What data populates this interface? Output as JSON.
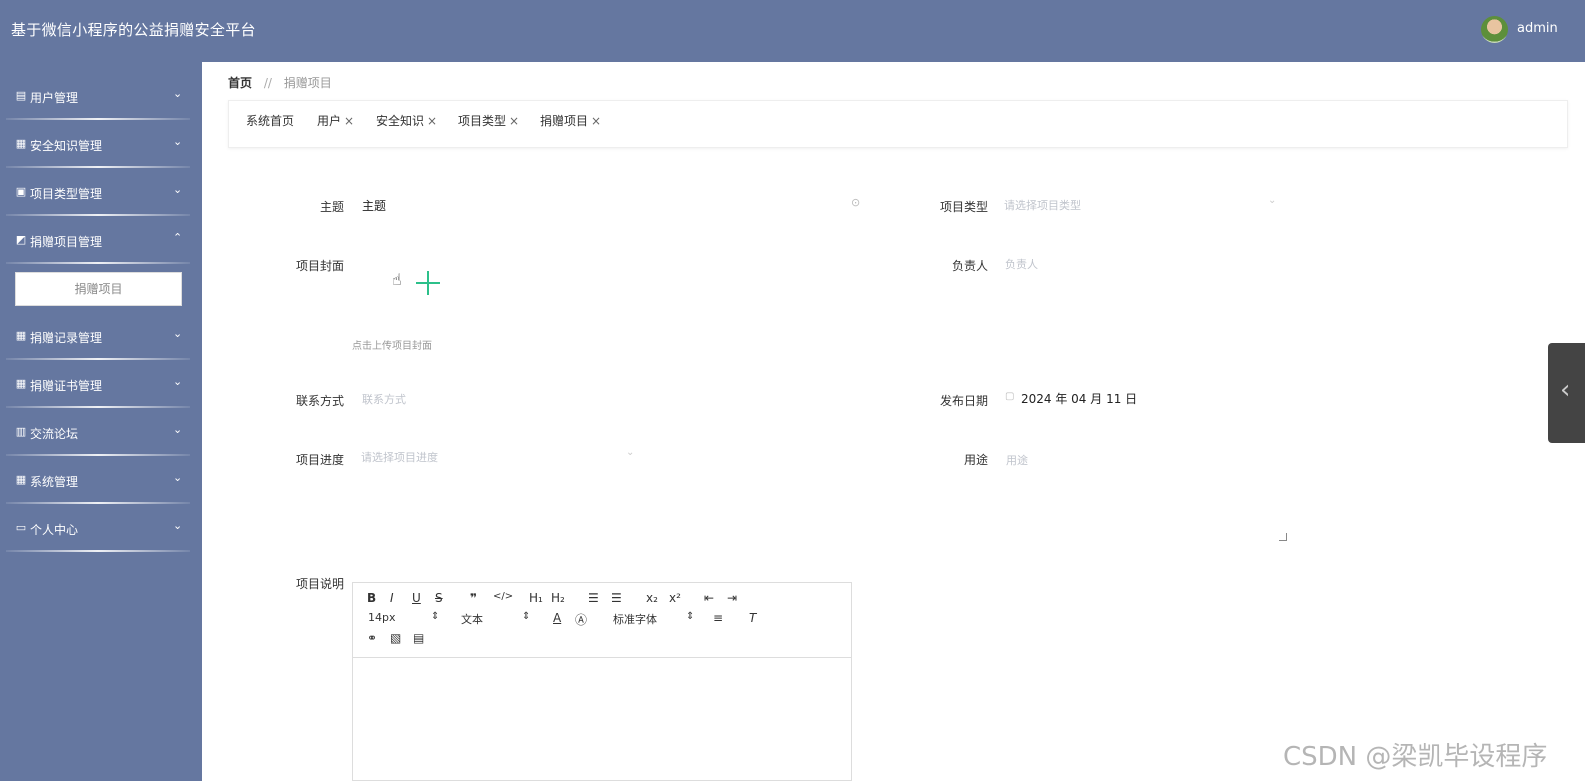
{
  "app": {
    "title": "基于微信小程序的公益捐赠安全平台",
    "user": "admin"
  },
  "sidebar": {
    "items": [
      {
        "label": "用户管理",
        "icon": "chart-icon",
        "chev": "⌄"
      },
      {
        "label": "安全知识管理",
        "icon": "grid-icon",
        "chev": "⌄"
      },
      {
        "label": "项目类型管理",
        "icon": "briefcase-icon",
        "chev": "⌄"
      },
      {
        "label": "捐赠项目管理",
        "icon": "thumb-icon",
        "chev": "⌃"
      },
      {
        "label": "捐赠记录管理",
        "icon": "grid-icon",
        "chev": "⌄"
      },
      {
        "label": "捐赠证书管理",
        "icon": "grid-icon",
        "chev": "⌄"
      },
      {
        "label": "交流论坛",
        "icon": "clipboard-icon",
        "chev": "⌄"
      },
      {
        "label": "系统管理",
        "icon": "grid-icon",
        "chev": "⌄"
      },
      {
        "label": "个人中心",
        "icon": "card-icon",
        "chev": "⌄"
      }
    ],
    "sub_item": "捐赠项目"
  },
  "breadcrumb": {
    "home": "首页",
    "sep": "//",
    "current": "捐赠项目"
  },
  "tags": [
    {
      "label": "系统首页",
      "close": ""
    },
    {
      "label": "用户",
      "close": "×"
    },
    {
      "label": "安全知识",
      "close": "×"
    },
    {
      "label": "项目类型",
      "close": "×"
    },
    {
      "label": "捐赠项目",
      "close": "×"
    }
  ],
  "form": {
    "subject": {
      "label": "主题",
      "value": "主题"
    },
    "type": {
      "label": "项目类型",
      "placeholder": "请选择项目类型"
    },
    "cover": {
      "label": "项目封面",
      "hint": "点击上传项目封面"
    },
    "leader": {
      "label": "负责人",
      "placeholder": "负责人"
    },
    "contact": {
      "label": "联系方式",
      "placeholder": "联系方式"
    },
    "date": {
      "label": "发布日期",
      "value": "2024 年 04 月 11 日"
    },
    "progress": {
      "label": "项目进度",
      "placeholder": "请选择项目进度"
    },
    "usage": {
      "label": "用途",
      "placeholder": "用途"
    },
    "description": {
      "label": "项目说明"
    }
  },
  "editor": {
    "font_size": "14px",
    "heading": "文本",
    "font_family": "标准字体"
  },
  "watermark": "CSDN @梁凯毕设程序"
}
